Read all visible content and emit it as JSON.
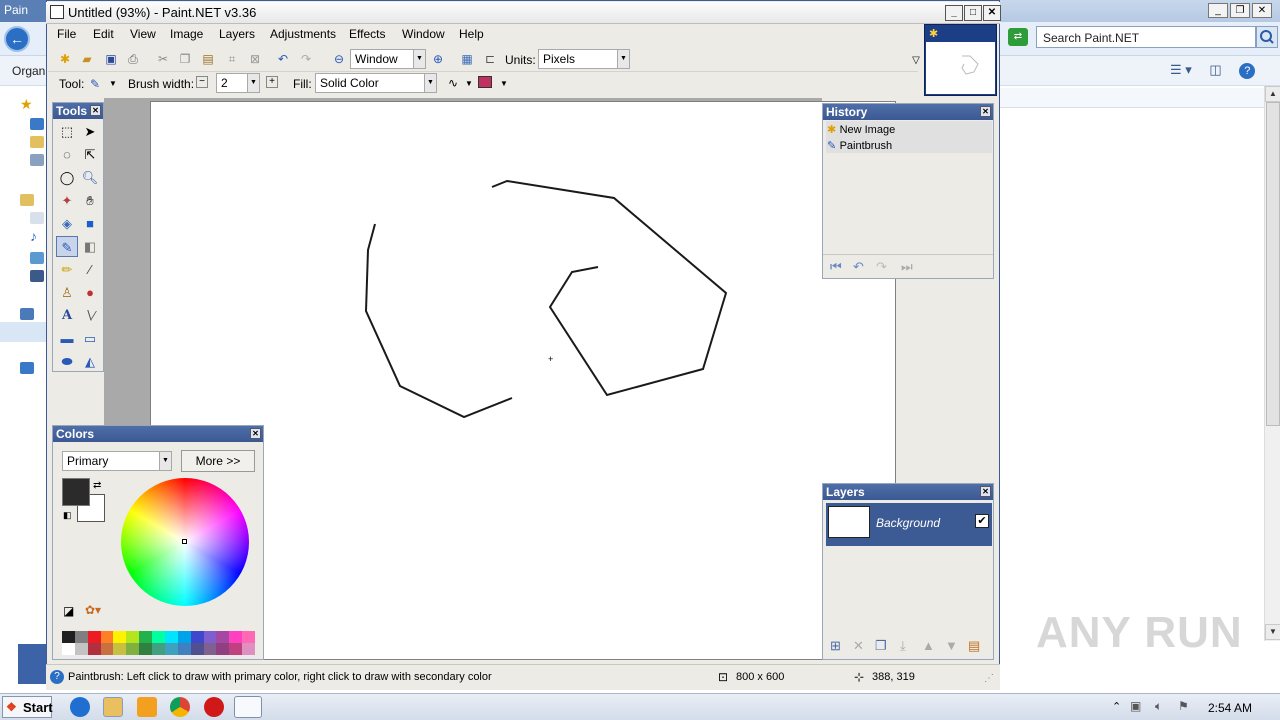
{
  "background_window": {
    "title": "Pain",
    "organize_label": "Organi",
    "search_placeholder": "Search Paint.NET"
  },
  "paintnet": {
    "title": "Untitled (93%) - Paint.NET v3.36",
    "menu": [
      "File",
      "Edit",
      "View",
      "Image",
      "Layers",
      "Adjustments",
      "Effects",
      "Window",
      "Help"
    ],
    "toolbar": {
      "zoom_value": "Window",
      "units_label": "Units:",
      "units_value": "Pixels",
      "tool_label": "Tool:",
      "brush_width_label": "Brush width:",
      "brush_width_value": "2",
      "fill_label": "Fill:",
      "fill_value": "Solid Color"
    },
    "tools_panel": {
      "title": "Tools"
    },
    "colors_panel": {
      "title": "Colors",
      "selector_value": "Primary",
      "more_button": "More >>",
      "primary_color": "#2b2b2b",
      "secondary_color": "#ffffff",
      "palette_top": [
        "#202020",
        "#7f7f7f",
        "#ed1c24",
        "#ff7f27",
        "#fff200",
        "#b5e61d",
        "#22b14c",
        "#00ffa0",
        "#00e5ff",
        "#00a2e8",
        "#3f48cc",
        "#7f5fd0",
        "#a349a4",
        "#ff40c0",
        "#ff69b4"
      ],
      "palette_bottom": [
        "#ffffff",
        "#c3c3c3",
        "#b03040",
        "#c87040",
        "#c8c040",
        "#80b040",
        "#308040",
        "#40a080",
        "#40a0c0",
        "#4080c0",
        "#505090",
        "#806090",
        "#904080",
        "#c04080",
        "#e090c0"
      ]
    },
    "history_panel": {
      "title": "History",
      "items": [
        "New Image",
        "Paintbrush"
      ]
    },
    "layers_panel": {
      "title": "Layers",
      "layer_name": "Background"
    },
    "status": {
      "hint": "Paintbrush: Left click to draw with primary color, right click to draw with secondary color",
      "image_size": "800 x 600",
      "cursor_pos": "388, 319"
    }
  },
  "taskbar": {
    "start_label": "Start",
    "clock": "2:54 AM"
  },
  "watermark": "ANY RUN"
}
